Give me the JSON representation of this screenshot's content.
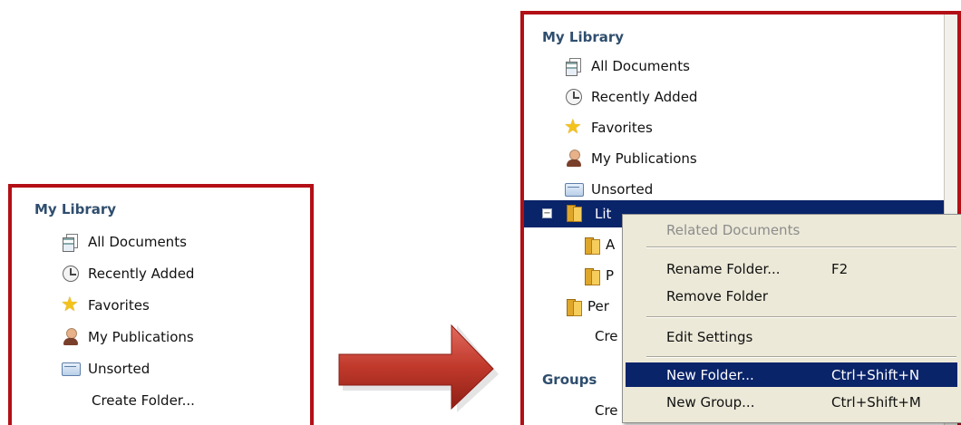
{
  "left_panel": {
    "title": "My Library",
    "items": [
      {
        "label": "All Documents",
        "icon": "all-documents-icon"
      },
      {
        "label": "Recently Added",
        "icon": "clock-icon"
      },
      {
        "label": "Favorites",
        "icon": "star-icon"
      },
      {
        "label": "My Publications",
        "icon": "person-icon"
      },
      {
        "label": "Unsorted",
        "icon": "inbox-icon"
      }
    ],
    "create_folder": "Create Folder..."
  },
  "right_panel": {
    "title": "My Library",
    "items": [
      {
        "label": "All Documents",
        "icon": "all-documents-icon"
      },
      {
        "label": "Recently Added",
        "icon": "clock-icon"
      },
      {
        "label": "Favorites",
        "icon": "star-icon"
      },
      {
        "label": "My Publications",
        "icon": "person-icon"
      },
      {
        "label": "Unsorted",
        "icon": "inbox-icon"
      }
    ],
    "selected_folder_label": "Lit",
    "subfolder_a": "A",
    "subfolder_p": "P",
    "folder_per": "Per",
    "create_truncated": "Cre",
    "groups_title": "Groups",
    "groups_create_truncated": "Cre"
  },
  "context_menu": {
    "related": "Related Documents",
    "rename": "Rename Folder...",
    "rename_shortcut": "F2",
    "remove": "Remove Folder",
    "edit_settings": "Edit Settings",
    "new_folder": "New Folder...",
    "new_folder_shortcut": "Ctrl+Shift+N",
    "new_group": "New Group...",
    "new_group_shortcut": "Ctrl+Shift+M"
  },
  "colors": {
    "frame": "#b30f16",
    "selection": "#0a246a",
    "section_title": "#2f4e6e",
    "arrow": "#c0392b"
  }
}
